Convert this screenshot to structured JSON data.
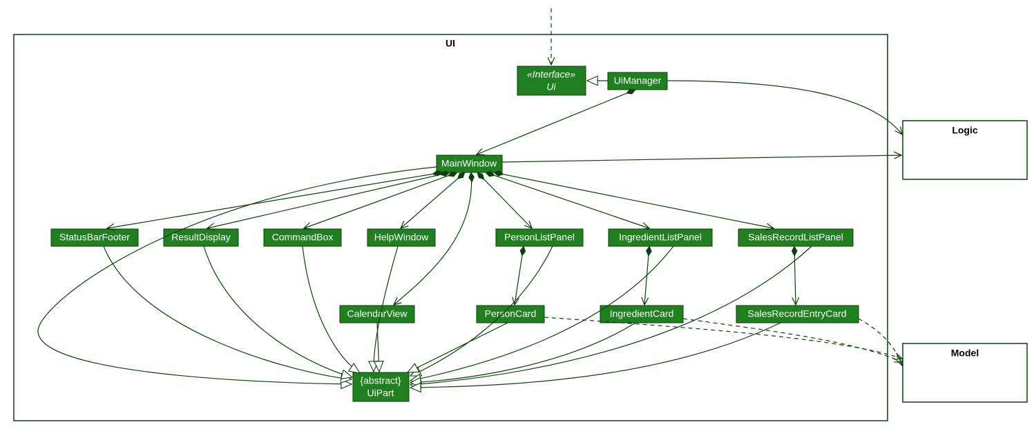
{
  "packages": {
    "ui": {
      "label": "UI"
    },
    "logic": {
      "label": "Logic"
    },
    "model": {
      "label": "Model"
    }
  },
  "classes": {
    "uiInterface": {
      "stereotype": "«Interface»",
      "name": "Ui"
    },
    "uiManager": {
      "name": "UiManager"
    },
    "mainWindow": {
      "name": "MainWindow"
    },
    "statusBarFooter": {
      "name": "StatusBarFooter"
    },
    "resultDisplay": {
      "name": "ResultDisplay"
    },
    "commandBox": {
      "name": "CommandBox"
    },
    "helpWindow": {
      "name": "HelpWindow"
    },
    "personListPanel": {
      "name": "PersonListPanel"
    },
    "ingredientListPanel": {
      "name": "IngredientListPanel"
    },
    "salesRecordListPanel": {
      "name": "SalesRecordListPanel"
    },
    "calendarView": {
      "name": "CalendarView"
    },
    "personCard": {
      "name": "PersonCard"
    },
    "ingredientCard": {
      "name": "IngredientCard"
    },
    "salesRecordEntryCard": {
      "name": "SalesRecordEntryCard"
    },
    "uiPart": {
      "stereotype": "{abstract}",
      "name": "UiPart"
    }
  },
  "colors": {
    "classFill": "#208020",
    "stroke": "#0b3f0b",
    "background": "#ffffff"
  }
}
